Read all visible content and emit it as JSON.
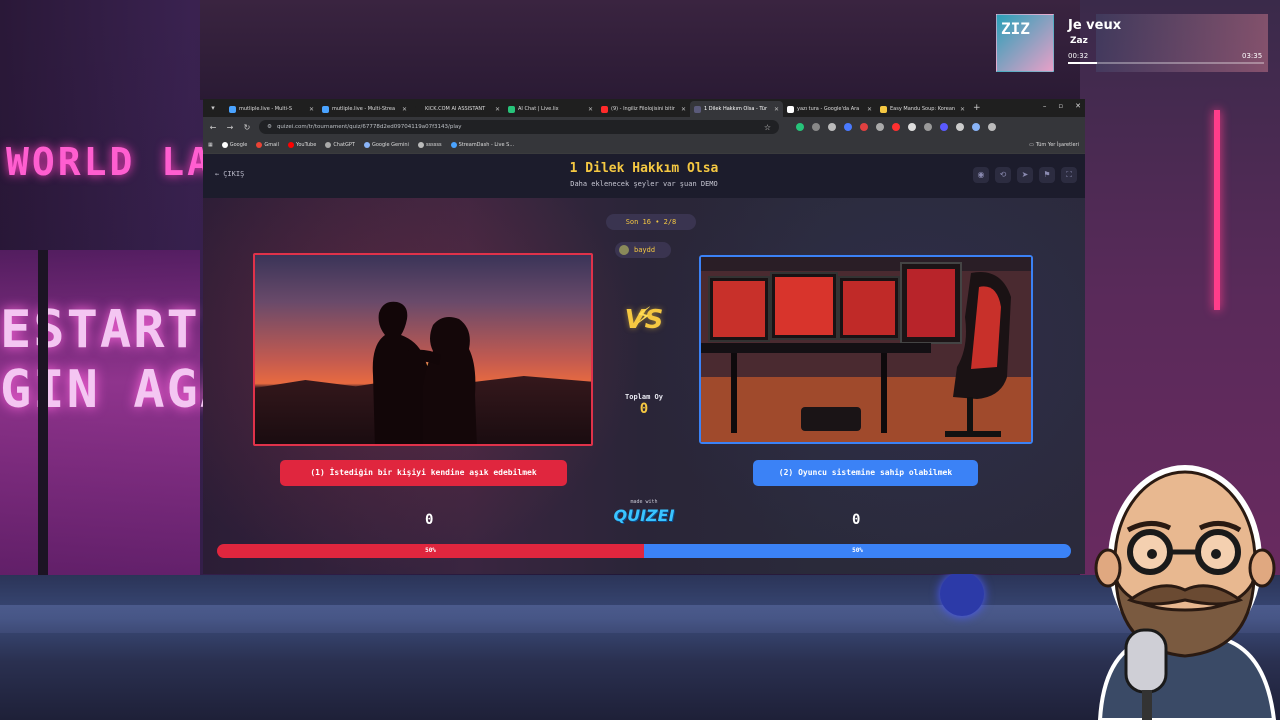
{
  "music": {
    "cover_text": "ZIZ",
    "title": "Je veux",
    "artist": "Zaz",
    "time_current": "00:32",
    "time_total": "03:35",
    "progress": 0.15
  },
  "background": {
    "world_text": "WORLD LA",
    "shop_line1": "ESTART",
    "shop_line2": "GIN AGAIN"
  },
  "browser": {
    "tabs": [
      {
        "label": "mutliple.live - Multi-S",
        "color": "#4aa3ff",
        "active": false
      },
      {
        "label": "mutliple.live - Multi-Strea",
        "color": "#4aa3ff",
        "active": false
      },
      {
        "label": "KICK.COM AI ASSISTANT",
        "color": "#1f1f1f",
        "active": false
      },
      {
        "label": "AI Chat | Live.lix",
        "color": "#27c47a",
        "active": false
      },
      {
        "label": "(9) - İngiliz Filolojisini bitir",
        "color": "#ff2a2a",
        "active": false
      },
      {
        "label": "1 Dilek Hakkım Olsa - Tür",
        "color": "#5a5a7a",
        "active": true
      },
      {
        "label": "yazı tura - Google'da Ara",
        "color": "#ffffff",
        "active": false
      },
      {
        "label": "Easy Mandu Soup: Korean",
        "color": "#f5c842",
        "active": false
      }
    ],
    "url": "quizei.com/tr/tournament/quiz/67778d2ed09704119a07f3143/play",
    "bookmarks": [
      {
        "label": "Google",
        "color": "#ffffff"
      },
      {
        "label": "Gmail",
        "color": "#ea4335"
      },
      {
        "label": "YouTube",
        "color": "#ff0000"
      },
      {
        "label": "ChatGPT",
        "color": "#aaaaaa"
      },
      {
        "label": "Google Gemini",
        "color": "#8ab4f8"
      },
      {
        "label": "ssssss",
        "color": "#bbbbbb"
      },
      {
        "label": "StreamDash - Live S...",
        "color": "#4aa3ff"
      }
    ],
    "bookmarks_right": "Tüm Yer İşaretleri"
  },
  "quiz": {
    "back_label": "ÇIKIŞ",
    "title": "1 Dilek Hakkım Olsa",
    "subtitle": "Daha eklenecek şeyler var şuan DEMO",
    "round": "Son 16 • 2/8",
    "user": "baydd",
    "vs": "VS",
    "total_label": "Toplam Oy",
    "total_votes": "0",
    "option_left": "(1) İstediğin bir kişiyi kendine aşık edebilmek",
    "option_right": "(2) Oyuncu sistemine sahip olabilmek",
    "votes_left": "0",
    "votes_right": "0",
    "made_with": "made with",
    "brand": "QUIZEI",
    "pct_left": "50%",
    "pct_right": "50%"
  },
  "colors": {
    "accent_yellow": "#f5c842",
    "left_red": "#e0263e",
    "right_blue": "#3b82f6"
  }
}
